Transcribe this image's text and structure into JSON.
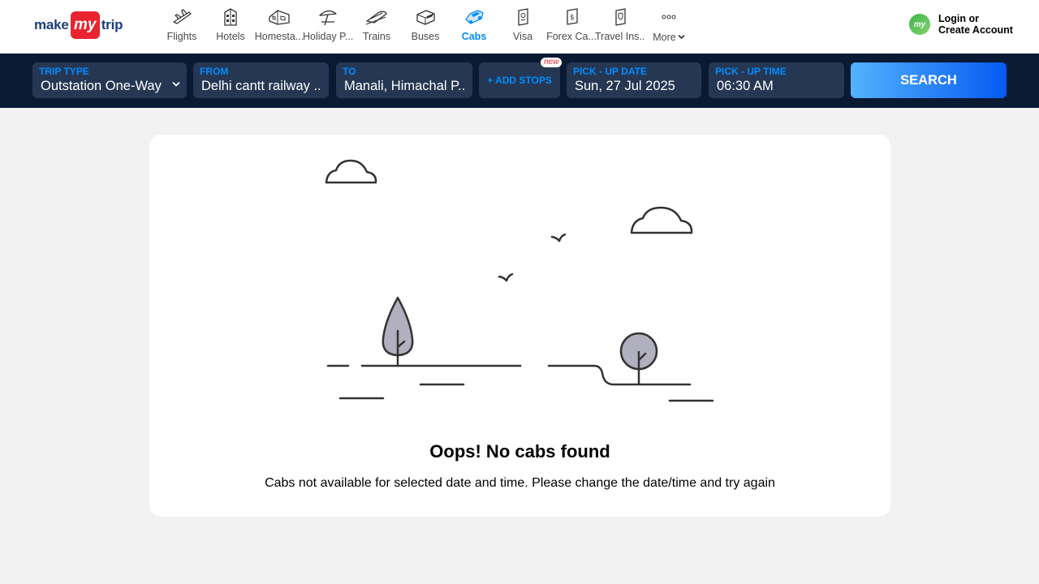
{
  "logo": {
    "part1": "make",
    "part2": "my",
    "part3": "trip"
  },
  "nav": [
    {
      "label": "Flights",
      "icon": "plane-icon"
    },
    {
      "label": "Hotels",
      "icon": "hotel-icon"
    },
    {
      "label": "Homesta...",
      "icon": "homestay-icon"
    },
    {
      "label": "Holiday P...",
      "icon": "holiday-icon"
    },
    {
      "label": "Trains",
      "icon": "train-icon"
    },
    {
      "label": "Buses",
      "icon": "bus-icon"
    },
    {
      "label": "Cabs",
      "icon": "cab-icon"
    },
    {
      "label": "Visa",
      "icon": "visa-icon"
    },
    {
      "label": "Forex Ca...",
      "icon": "forex-icon"
    },
    {
      "label": "Travel Ins...",
      "icon": "insurance-icon"
    },
    {
      "label": "More",
      "icon": "more-icon"
    }
  ],
  "login": {
    "avatar": "my",
    "line1": "Login or",
    "line2": "Create Account"
  },
  "search": {
    "trip_type": {
      "caption": "TRIP TYPE",
      "value": "Outstation One-Way"
    },
    "from": {
      "caption": "FROM",
      "value": "Delhi cantt railway ..."
    },
    "to": {
      "caption": "TO",
      "value": "Manali, Himachal P..."
    },
    "add_stops": "+ ADD STOPS",
    "new_badge": "new",
    "pickup_date": {
      "caption": "PICK - UP DATE",
      "value": "Sun, 27 Jul 2025"
    },
    "pickup_time": {
      "caption": "PICK - UP TIME",
      "value": "06:30 AM"
    },
    "button": "SEARCH"
  },
  "empty_state": {
    "title": "Oops! No cabs found",
    "message": "Cabs not available for selected date and time. Please change the date/time and try again"
  },
  "colors": {
    "accent": "#008cff",
    "brand_red": "#ea2330",
    "nav_bar": "#0b1a33",
    "field_bg": "#263753"
  }
}
